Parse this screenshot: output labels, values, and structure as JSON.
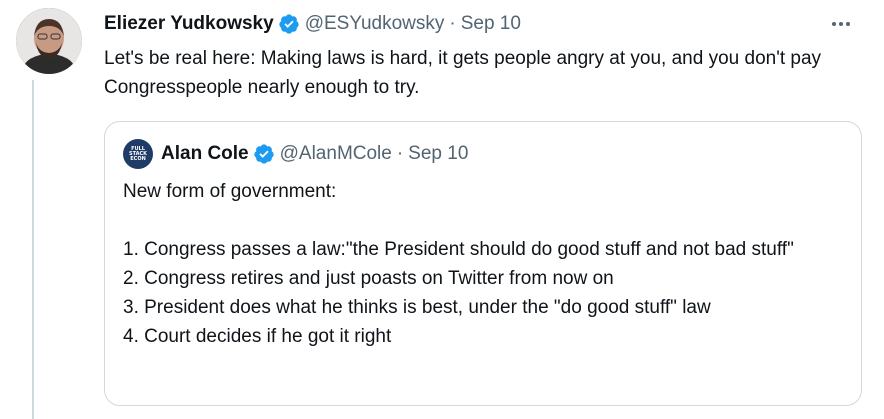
{
  "tweet": {
    "author_name": "Eliezer Yudkowsky",
    "handle": "@ESYudkowsky",
    "separator": "·",
    "date": "Sep 10",
    "text": "Let's be real here:  Making laws is hard, it gets people angry at you, and you don't pay Congresspeople nearly enough to try.",
    "avatar_icon": "profile-photo",
    "verified_icon": "verified-badge-icon",
    "more_icon": "more-options-icon"
  },
  "quote": {
    "author_name": "Alan Cole",
    "handle": "@AlanMCole",
    "separator": "·",
    "date": "Sep 10",
    "avatar_logo_lines": [
      "FULL",
      "STACK",
      "ECON"
    ],
    "text": "New form of government:\n\n1. Congress passes a law:\"the President should do good stuff and not bad stuff\"\n2. Congress retires and just poasts on Twitter from now on\n3. President does what he thinks is best, under the \"do good stuff\" law\n4. Court decides if he got it right"
  },
  "colors": {
    "verified": "#1d9bf0",
    "secondary_text": "#536471",
    "border": "#cfd9de",
    "primary_text": "#0f1419"
  }
}
